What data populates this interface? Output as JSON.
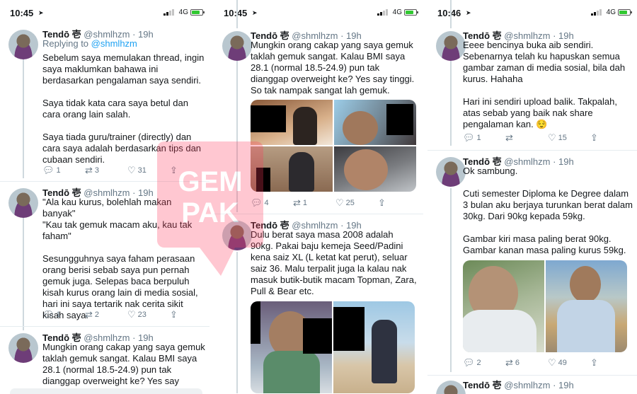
{
  "status": {
    "panel1": {
      "time": "10:45",
      "network": "4G"
    },
    "panel2": {
      "time": "10:45",
      "network": "4G"
    },
    "panel3": {
      "time": "10:46",
      "network": "4G"
    }
  },
  "author": {
    "name": "Tendō 壱",
    "handle": "@shmlhzm",
    "age": "19h"
  },
  "watermark": {
    "text": "GEMPAK"
  },
  "panel1": {
    "t1": {
      "replying_label": "Replying to",
      "replying_to": "@shmlhzm",
      "text": "Sebelum saya memulakan thread, ingin saya maklumkan bahawa ini berdasarkan pengalaman saya sendiri.\n\nSaya tidak kata cara saya betul dan cara orang lain salah.\n\nSaya tiada guru/trainer (directly) dan cara saya adalah berdasarkan tips dan cubaan sendiri.",
      "replies": "1",
      "retweets": "3",
      "likes": "31"
    },
    "t2": {
      "text": "\"Ala kau kurus, bolehlah makan banyak\"\n\"Kau tak gemuk macam aku, kau tak faham\"\n\nSesungguhnya saya faham perasaan orang berisi sebab saya pun pernah gemuk juga. Selepas baca berpuluh kisah kurus orang lain di media sosial, hari ini saya tertarik nak cerita sikit kisah saya.",
      "replies": "1",
      "retweets": "2",
      "likes": "23"
    },
    "t3": {
      "text": "Mungkin orang cakap yang saya gemuk taklah gemuk sangat. Kalau BMI saya 28.1 (normal 18.5-24.9) pun tak dianggap overweight ke? Yes say tinggi. So tak"
    }
  },
  "panel2": {
    "t1": {
      "text": "Mungkin orang cakap yang saya gemuk taklah gemuk sangat. Kalau BMI saya 28.1 (normal 18.5-24.9) pun tak dianggap overweight ke? Yes say tinggi. So tak nampak sangat lah gemuk.",
      "replies": "4",
      "retweets": "1",
      "likes": "25"
    },
    "t2": {
      "text": "Dulu berat saya masa 2008 adalah 90kg. Pakai baju kemeja Seed/Padini kena saiz XL (L ketat kat perut), seluar saiz 36. Malu terpalit juga la kalau nak masuk butik-butik macam Topman, Zara, Pull & Bear etc."
    }
  },
  "panel3": {
    "t1": {
      "text": "Eeee bencinya buka aib sendiri. Sebenarnya telah ku hapuskan semua gambar zaman di media sosial, bila dah kurus. Hahaha\n\nHari ini sendiri upload balik. Takpalah, atas sebab yang baik nak share pengalaman kan. 😌",
      "replies": "1",
      "retweets": "",
      "likes": "15"
    },
    "t2": {
      "text": "Ok sambung.\n\nCuti semester Diploma ke Degree dalam 3 bulan aku berjaya turunkan berat dalam 30kg. Dari 90kg kepada 59kg.\n\nGambar kiri masa paling berat 90kg. Gambar kanan masa paling kurus 59kg.",
      "replies": "2",
      "retweets": "6",
      "likes": "49"
    }
  },
  "icons": {
    "reply": "reply-icon",
    "retweet": "retweet-icon",
    "like": "heart-icon",
    "share": "share-icon",
    "more": "chevron-down-icon"
  },
  "colors": {
    "link": "#1da1f2",
    "muted": "#657786",
    "battery": "#31c831",
    "watermark": "#ff3b5c"
  }
}
